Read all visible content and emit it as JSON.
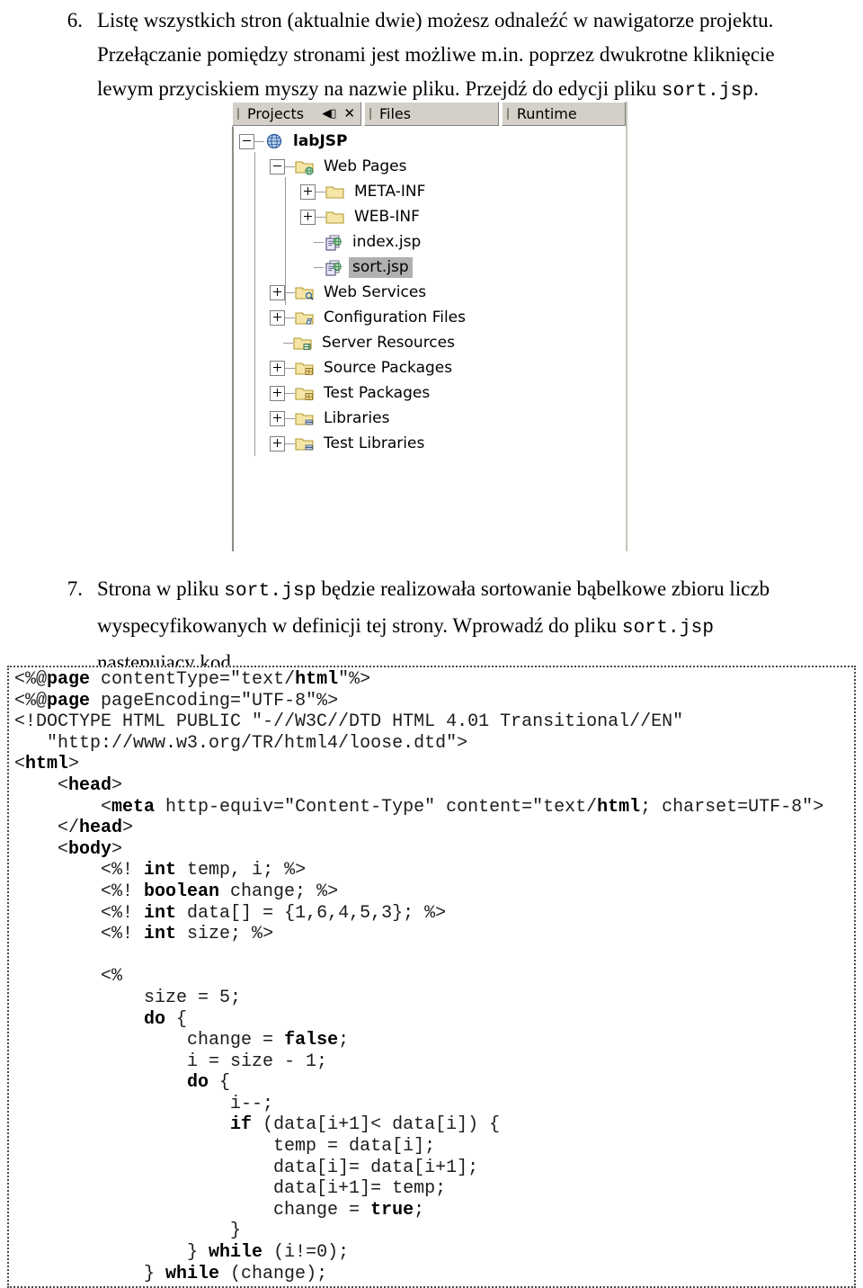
{
  "paragraphs": [
    {
      "number": "6.",
      "lines": [
        [
          {
            "t": "text",
            "v": "Listę wszystkich stron (aktualnie dwie) możesz odnaleźć w nawigatorze projektu."
          }
        ],
        [
          {
            "t": "text",
            "v": "Przełączanie pomiędzy stronami jest możliwe m.in. poprzez dwukrotne kliknięcie"
          }
        ],
        [
          {
            "t": "text",
            "v": "lewym przyciskiem myszy na nazwie pliku. Przejdź do edycji pliku "
          },
          {
            "t": "mono",
            "v": "sort.jsp"
          },
          {
            "t": "text",
            "v": "."
          }
        ]
      ]
    },
    {
      "number": "7.",
      "lines": [
        [
          {
            "t": "text",
            "v": "Strona w pliku "
          },
          {
            "t": "mono",
            "v": "sort.jsp"
          },
          {
            "t": "text",
            "v": " będzie realizowała sortowanie bąbelkowe zbioru liczb"
          }
        ],
        [
          {
            "t": "text",
            "v": "wyspecyfikowanych w definicji tej strony. Wprowadź do pliku "
          },
          {
            "t": "mono",
            "v": "sort.jsp"
          }
        ],
        [
          {
            "t": "text",
            "v": "następujący kod."
          }
        ]
      ]
    }
  ],
  "projects_panel": {
    "tabs": [
      {
        "label": "Projects",
        "active": true,
        "has_buttons": true
      },
      {
        "label": "Files",
        "active": false,
        "has_buttons": false
      },
      {
        "label": "Runtime",
        "active": false,
        "has_buttons": false
      }
    ],
    "window_buttons": {
      "minimize_glyph": "◀▯",
      "close_glyph": "✕"
    },
    "tree": [
      {
        "label": "labJSP",
        "depth": 0,
        "icon": "project-globe-icon",
        "expander": "minus",
        "bold": true,
        "selected": false
      },
      {
        "label": "Web Pages",
        "depth": 1,
        "icon": "folder-webpages-icon",
        "expander": "minus",
        "bold": false,
        "selected": false
      },
      {
        "label": "META-INF",
        "depth": 2,
        "icon": "folder-plain-icon",
        "expander": "plus",
        "bold": false,
        "selected": false
      },
      {
        "label": "WEB-INF",
        "depth": 2,
        "icon": "folder-plain-icon",
        "expander": "plus",
        "bold": false,
        "selected": false
      },
      {
        "label": "index.jsp",
        "depth": 2,
        "icon": "jsp-file-icon",
        "expander": "none",
        "bold": false,
        "selected": false
      },
      {
        "label": "sort.jsp",
        "depth": 2,
        "icon": "jsp-file-icon",
        "expander": "none",
        "bold": false,
        "selected": true
      },
      {
        "label": "Web Services",
        "depth": 1,
        "icon": "folder-webservices-icon",
        "expander": "plus",
        "bold": false,
        "selected": false
      },
      {
        "label": "Configuration Files",
        "depth": 1,
        "icon": "folder-config-icon",
        "expander": "plus",
        "bold": false,
        "selected": false
      },
      {
        "label": "Server Resources",
        "depth": 1,
        "icon": "folder-server-icon",
        "expander": "none",
        "bold": false,
        "selected": false
      },
      {
        "label": "Source Packages",
        "depth": 1,
        "icon": "folder-packages-icon",
        "expander": "plus",
        "bold": false,
        "selected": false
      },
      {
        "label": "Test Packages",
        "depth": 1,
        "icon": "folder-packages-icon",
        "expander": "plus",
        "bold": false,
        "selected": false
      },
      {
        "label": "Libraries",
        "depth": 1,
        "icon": "folder-libraries-icon",
        "expander": "plus",
        "bold": false,
        "selected": false
      },
      {
        "label": "Test Libraries",
        "depth": 1,
        "icon": "folder-libraries-icon",
        "expander": "plus",
        "bold": false,
        "selected": false
      }
    ],
    "colors": {
      "tab_background": "#d4d0c8",
      "selection": "#b0b0b0",
      "folder_fill": "#f5e6a8",
      "folder_edge": "#b59a30",
      "globe_blue": "#4a7fc1"
    }
  },
  "code_listing": {
    "language": "jsp",
    "lines": [
      "<%@page contentType=\"text/html\"%>",
      "<%@page pageEncoding=\"UTF-8\"%>",
      "<!DOCTYPE HTML PUBLIC \"-//W3C//DTD HTML 4.01 Transitional//EN\"",
      "   \"http://www.w3.org/TR/html4/loose.dtd\">",
      "<html>",
      "    <head>",
      "        <meta http-equiv=\"Content-Type\" content=\"text/html; charset=UTF-8\">",
      "    </head>",
      "    <body>",
      "        <%! int temp, i; %>",
      "        <%! boolean change; %>",
      "        <%! int data[] = {1,6,4,5,3}; %>",
      "        <%! int size; %>",
      "",
      "        <%",
      "            size = 5;",
      "            do {",
      "                change = false;",
      "                i = size - 1;",
      "                do {",
      "                    i--;",
      "                    if (data[i+1]< data[i]) {",
      "                        temp = data[i];",
      "                        data[i]= data[i+1];",
      "                        data[i+1]= temp;",
      "                        change = true;",
      "                    }",
      "                } while (i!=0);",
      "            } while (change);"
    ],
    "bold_tokens": [
      "page",
      "html",
      "head",
      "meta",
      "body",
      "int",
      "boolean",
      "do",
      "while",
      "if",
      "false",
      "true"
    ]
  }
}
